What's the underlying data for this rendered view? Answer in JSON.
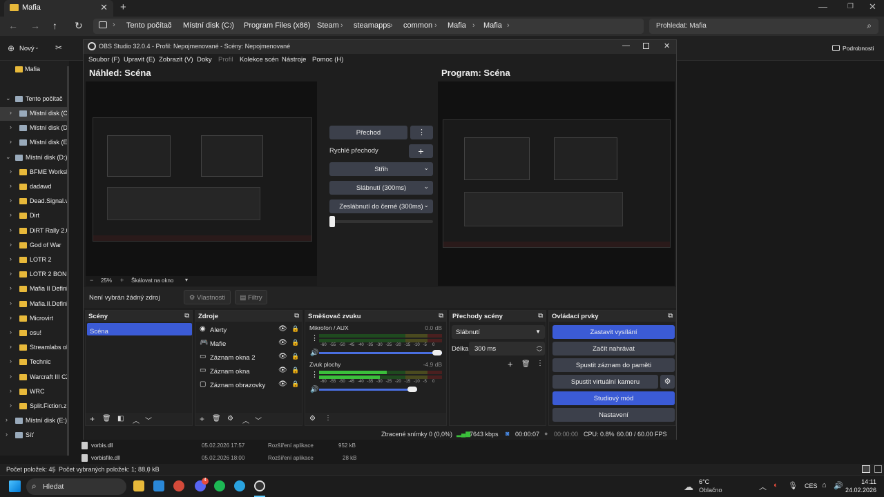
{
  "explorer": {
    "tab_title": "Mafia",
    "breadcrumbs": [
      "Tento počítač",
      "Místní disk (C:)",
      "Program Files (x86)",
      "Steam",
      "steamapps",
      "common",
      "Mafia",
      "Mafia"
    ],
    "search_placeholder": "Prohledat: Mafia",
    "new_label": "Nový",
    "details_label": "Podrobnosti",
    "sidebar": [
      {
        "label": "Mafia",
        "level": 1
      },
      {
        "label": "Tento počítač",
        "level": 0
      },
      {
        "label": "Místní disk (C:",
        "level": 1
      },
      {
        "label": "Místní disk (D:",
        "level": 1
      },
      {
        "label": "Místní disk (E:)",
        "level": 1
      },
      {
        "label": "Místní disk (D:)",
        "level": 0
      },
      {
        "label": "BFME Worksho",
        "level": 1
      },
      {
        "label": "dadawd",
        "level": 1
      },
      {
        "label": "Dead.Signal.v2",
        "level": 1
      },
      {
        "label": "Dirt",
        "level": 1
      },
      {
        "label": "DiRT Rally 2.0",
        "level": 1
      },
      {
        "label": "God of War",
        "level": 1
      },
      {
        "label": "LOTR 2",
        "level": 1
      },
      {
        "label": "LOTR 2 BONUS",
        "level": 1
      },
      {
        "label": "Mafia II Definit",
        "level": 1
      },
      {
        "label": "Mafia.II.Definit",
        "level": 1
      },
      {
        "label": "Microvirt",
        "level": 1
      },
      {
        "label": "osu!",
        "level": 1
      },
      {
        "label": "Streamlabs ob",
        "level": 1
      },
      {
        "label": "Technic",
        "level": 1
      },
      {
        "label": "Warcraft III CZ",
        "level": 1
      },
      {
        "label": "WRC",
        "level": 1
      },
      {
        "label": "Split.Fiction.zip",
        "level": 1
      },
      {
        "label": "Místní disk (E:)",
        "level": 0
      },
      {
        "label": "Síť",
        "level": 0
      }
    ],
    "files": [
      {
        "name": "vorbis.dll",
        "date": "05.02.2026 17:57",
        "type": "Rozšíření aplikace",
        "size": "952 kB"
      },
      {
        "name": "vorbisfile.dll",
        "date": "05.02.2026 18:00",
        "type": "Rozšíření aplikace",
        "size": "28 kB"
      }
    ],
    "status_count": "Počet položek: 45",
    "status_selected": "Počet vybraných položek: 1; 88,0 kB"
  },
  "obs": {
    "title": "OBS Studio 32.0.4 - Profil: Nepojmenované - Scény: Nepojmenované",
    "menu": [
      "Soubor (F)",
      "Upravit (E)",
      "Zobrazit (V)",
      "Doky",
      "Profil",
      "Kolekce scén",
      "Nástroje",
      "Pomoc (H)"
    ],
    "preview_title": "Náhled: Scéna",
    "program_title": "Program: Scéna",
    "zoom": "25%",
    "scale_label": "Škálovat na okno",
    "transition_button": "Přechod",
    "quick_transitions": "Rychlé přechody",
    "quick_items": [
      "Střih",
      "Slábnutí (300ms)",
      "Zeslábnutí do černé (300ms)"
    ],
    "no_source": "Není vybrán žádný zdroj",
    "properties": "Vlastnosti",
    "filters": "Filtry",
    "docks": {
      "scenes": {
        "title": "Scény",
        "items": [
          "Scéna"
        ]
      },
      "sources": {
        "title": "Zdroje",
        "items": [
          "Alerty",
          "Mafie",
          "Záznam okna 2",
          "Záznam okna",
          "Záznam obrazovky"
        ]
      },
      "mixer": {
        "title": "Směšovač zvuku",
        "channels": [
          {
            "name": "Mikrofon / AUX",
            "db": "0.0 dB",
            "level": 0.0,
            "volume": 1.0
          },
          {
            "name": "Zvuk plochy",
            "db": "-4.9 dB",
            "level": 0.55,
            "volume": 0.8
          }
        ],
        "scale": [
          "-60",
          "-55",
          "-50",
          "-45",
          "-40",
          "-35",
          "-30",
          "-25",
          "-20",
          "-15",
          "-10",
          "-5",
          "0"
        ]
      },
      "transitions": {
        "title": "Přechody scény",
        "selected": "Slábnutí",
        "duration_label": "Délka",
        "duration": "300 ms"
      },
      "controls": {
        "title": "Ovládací prvky",
        "buttons": [
          "Zastavit vysílání",
          "Začít nahrávat",
          "Spustit záznam do paměti",
          "Spustit virtuální kameru",
          "Studiový mód",
          "Nastavení"
        ]
      }
    },
    "status": {
      "dropped": "Ztracené snímky 0 (0,0%)",
      "bitrate": "7643 kbps",
      "stream_time": "00:00:07",
      "rec_time": "00:00:00",
      "cpu": "CPU: 0.8%",
      "fps": "60.00 / 60.00 FPS"
    }
  },
  "taskbar": {
    "search": "Hledat",
    "weather_temp": "6°C",
    "weather_desc": "Oblačno",
    "lang": "CES",
    "time": "14:11",
    "date": "24.02.2026",
    "discord_badge": "4"
  },
  "colors": {
    "accent": "#3b5bd6",
    "button": "#3c404b",
    "meter_green": "#3bbf3b",
    "meter_yellow": "#a8a82a",
    "meter_red": "#b53030"
  }
}
